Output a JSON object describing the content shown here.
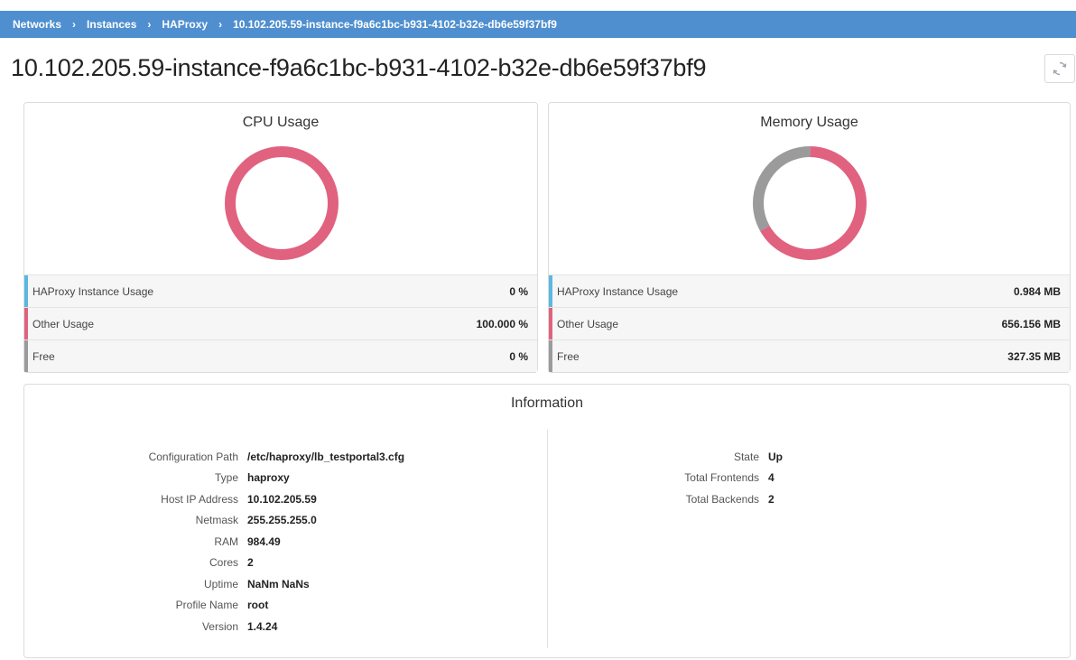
{
  "breadcrumb": {
    "items": [
      "Networks",
      "Instances",
      "HAProxy",
      "10.102.205.59-instance-f9a6c1bc-b931-4102-b32e-db6e59f37bf9"
    ],
    "separator": "›"
  },
  "page": {
    "title": "10.102.205.59-instance-f9a6c1bc-b931-4102-b32e-db6e59f37bf9",
    "refresh_icon": "refresh-icon"
  },
  "colors": {
    "accent": "#4f8fcf",
    "haproxy": "#5bb8e0",
    "other": "#e0627f",
    "free": "#9b9b9b"
  },
  "cpu": {
    "title": "CPU Usage",
    "legend": [
      {
        "label": "HAProxy Instance Usage",
        "value": "0 %",
        "color": "#5bb8e0"
      },
      {
        "label": "Other Usage",
        "value": "100.000 %",
        "color": "#e0627f"
      },
      {
        "label": "Free",
        "value": "0 %",
        "color": "#9b9b9b"
      }
    ]
  },
  "memory": {
    "title": "Memory Usage",
    "legend": [
      {
        "label": "HAProxy Instance Usage",
        "value": "0.984 MB",
        "color": "#5bb8e0"
      },
      {
        "label": "Other Usage",
        "value": "656.156 MB",
        "color": "#e0627f"
      },
      {
        "label": "Free",
        "value": "327.35 MB",
        "color": "#9b9b9b"
      }
    ]
  },
  "chart_data": [
    {
      "type": "pie",
      "title": "CPU Usage",
      "categories": [
        "HAProxy Instance Usage",
        "Other Usage",
        "Free"
      ],
      "values": [
        0,
        100,
        0
      ],
      "unit": "%"
    },
    {
      "type": "pie",
      "title": "Memory Usage",
      "categories": [
        "HAProxy Instance Usage",
        "Other Usage",
        "Free"
      ],
      "values": [
        0.984,
        656.156,
        327.35
      ],
      "unit": "MB"
    }
  ],
  "information": {
    "title": "Information",
    "left": [
      {
        "key": "Configuration Path",
        "value": "/etc/haproxy/lb_testportal3.cfg"
      },
      {
        "key": "Type",
        "value": "haproxy"
      },
      {
        "key": "Host IP Address",
        "value": "10.102.205.59"
      },
      {
        "key": "Netmask",
        "value": "255.255.255.0"
      },
      {
        "key": "RAM",
        "value": "984.49"
      },
      {
        "key": "Cores",
        "value": "2"
      },
      {
        "key": "Uptime",
        "value": "NaNm NaNs"
      },
      {
        "key": "Profile Name",
        "value": "root"
      },
      {
        "key": "Version",
        "value": "1.4.24"
      }
    ],
    "right": [
      {
        "key": "State",
        "value": "Up"
      },
      {
        "key": "Total Frontends",
        "value": "4"
      },
      {
        "key": "Total Backends",
        "value": "2"
      }
    ]
  }
}
